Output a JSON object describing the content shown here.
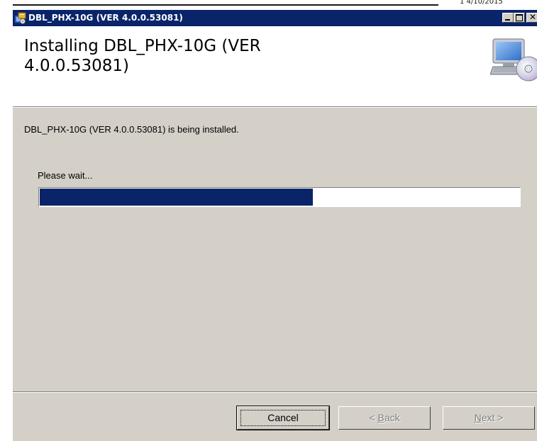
{
  "desktop": {
    "corner_text": "1 4/10/2015"
  },
  "window": {
    "title": "DBL_PHX-10G (VER 4.0.0.53081)",
    "close_glyph": "✕"
  },
  "banner": {
    "title": "Installing DBL_PHX-10G (VER 4.0.0.53081)"
  },
  "body": {
    "status_text": "DBL_PHX-10G (VER 4.0.0.53081) is being installed.",
    "wait_text": "Please wait..."
  },
  "progress": {
    "fraction": 0.57
  },
  "buttons": {
    "cancel_label": "Cancel",
    "back_prefix": "< ",
    "back_mnemonic": "B",
    "back_rest": "ack",
    "next_mnemonic": "N",
    "next_rest": "ext >"
  },
  "icons": {
    "title": "installer-icon",
    "banner": "computer-cd-icon"
  },
  "colors": {
    "titlebar": "#0a246a",
    "progress_fill": "#0a246a",
    "dialog_face": "#d4d0c8"
  }
}
